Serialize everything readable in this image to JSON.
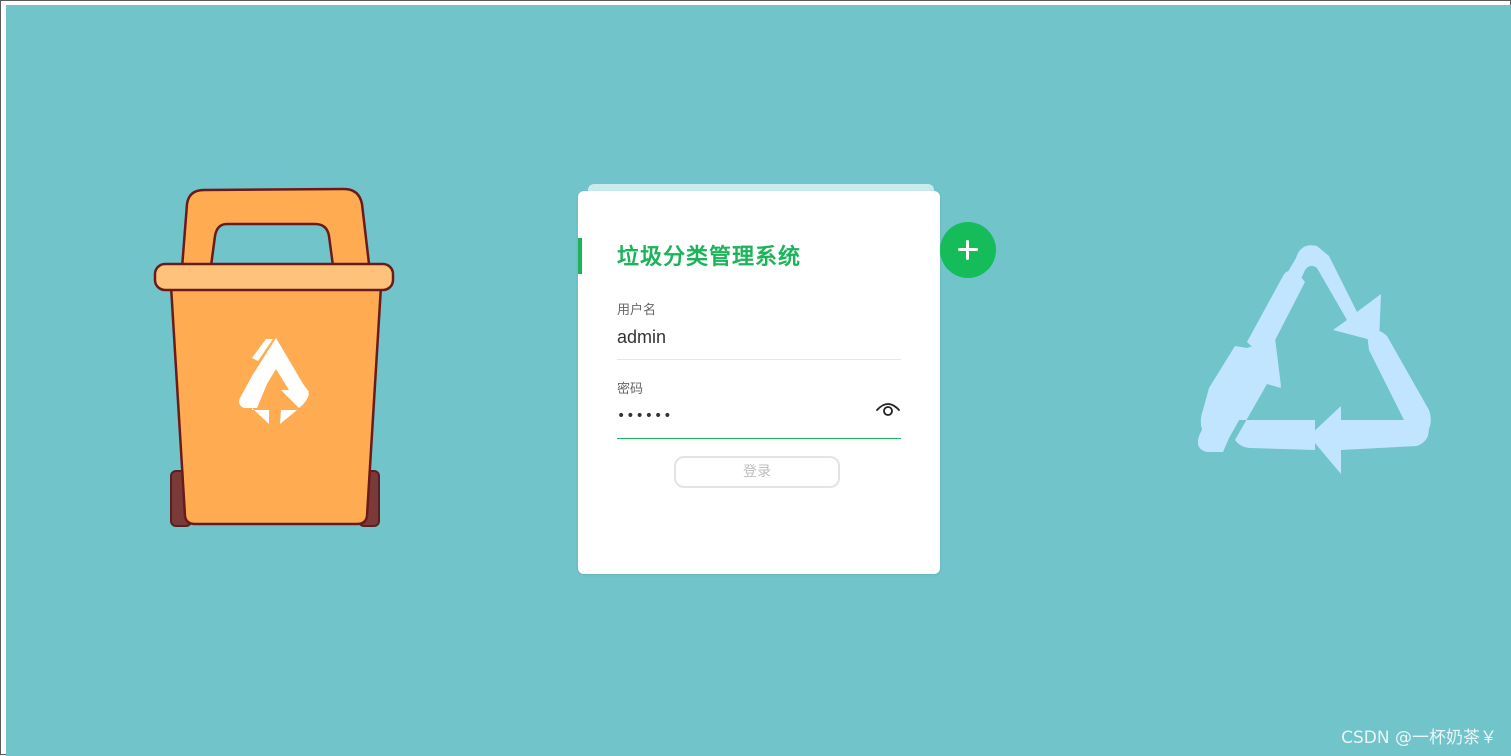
{
  "app": {
    "title": "垃圾分类管理系统"
  },
  "form": {
    "username_label": "用户名",
    "username_value": "admin",
    "password_label": "密码",
    "password_value": "••••••",
    "login_label": "登录"
  },
  "watermark": "CSDN @一杯奶茶￥",
  "colors": {
    "background": "#71c4ca",
    "accent_green": "#1cb45a",
    "trash_orange": "#ffab52",
    "recycle_blue": "#c2e5ff"
  },
  "icons": {
    "trash": "trash-bin-icon",
    "recycle": "recycle-icon",
    "plus": "plus-icon",
    "eye": "eye-icon"
  }
}
